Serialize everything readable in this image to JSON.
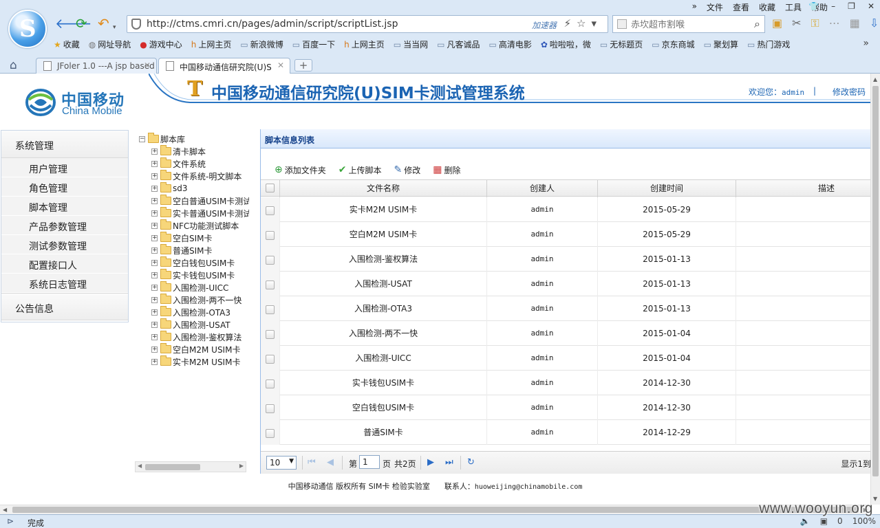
{
  "browser": {
    "menu": [
      "文件",
      "查看",
      "收藏",
      "工具",
      "帮助"
    ],
    "url": "http://ctms.cmri.cn/pages/admin/script/scriptList.jsp",
    "accelerator_label": "加速器",
    "search_placeholder": "赤坎超市割喉",
    "bookmarks": [
      {
        "icon": "star-icon",
        "label": "收藏"
      },
      {
        "icon": "globe-icon",
        "label": "网址导航"
      },
      {
        "icon": "game-icon",
        "label": "游戏中心"
      },
      {
        "icon": "hao-icon",
        "label": "上网主页"
      },
      {
        "icon": "page-icon",
        "label": "新浪微博"
      },
      {
        "icon": "page-icon",
        "label": "百度一下"
      },
      {
        "icon": "hao-icon",
        "label": "上网主页"
      },
      {
        "icon": "page-icon",
        "label": "当当网"
      },
      {
        "icon": "page-icon",
        "label": "凡客诚品"
      },
      {
        "icon": "page-icon",
        "label": "高清电影"
      },
      {
        "icon": "paw-icon",
        "label": "啦啦啦，微"
      },
      {
        "icon": "page-icon",
        "label": "无标题页"
      },
      {
        "icon": "page-icon",
        "label": "京东商城"
      },
      {
        "icon": "page-icon",
        "label": "聚划算"
      },
      {
        "icon": "page-icon",
        "label": "热门游戏"
      }
    ],
    "tabs": [
      {
        "label": "JFoler 1.0 ---A jsp based",
        "active": false
      },
      {
        "label": "中国移动通信研究院(U)S",
        "active": true
      }
    ],
    "status": "完成",
    "zoom": "100%",
    "status_count": "0",
    "watermark": "www.wooyun.org"
  },
  "header": {
    "brand_cn": "中国移动",
    "brand_en": "China Mobile",
    "title": "中国移动通信研究院(U)SIM卡测试管理系统",
    "welcome": "欢迎您：",
    "username": "admin",
    "separator": "|",
    "change_password": "修改密码"
  },
  "leftmenu": {
    "group1": "系统管理",
    "items": [
      "用户管理",
      "角色管理",
      "脚本管理",
      "产品参数管理",
      "测试参数管理",
      "配置接口人",
      "系统日志管理"
    ],
    "group2": "公告信息"
  },
  "tree": {
    "root": "脚本库",
    "children": [
      "清卡脚本",
      "文件系统",
      "文件系统-明文脚本",
      "sd3",
      "空白普通USIM卡测试",
      "实卡普通USIM卡测试",
      "NFC功能测试脚本",
      "空白SIM卡",
      "普通SIM卡",
      "空白钱包USIM卡",
      "实卡钱包USIM卡",
      "入围检测-UICC",
      "入围检测-两不一快",
      "入围检测-OTA3",
      "入围检测-USAT",
      "入围检测-鉴权算法",
      "空白M2M USIM卡",
      "实卡M2M USIM卡"
    ]
  },
  "panel": {
    "title": "脚本信息列表",
    "toolbar": {
      "add_folder": "添加文件夹",
      "upload": "上传脚本",
      "edit": "修改",
      "delete": "删除"
    },
    "columns": [
      "文件名称",
      "创建人",
      "创建时间",
      "描述"
    ],
    "rows": [
      {
        "name": "实卡M2M USIM卡",
        "creator": "admin",
        "date": "2015-05-29",
        "desc": ""
      },
      {
        "name": "空白M2M USIM卡",
        "creator": "admin",
        "date": "2015-05-29",
        "desc": ""
      },
      {
        "name": "入围检测-鉴权算法",
        "creator": "admin",
        "date": "2015-01-13",
        "desc": ""
      },
      {
        "name": "入围检测-USAT",
        "creator": "admin",
        "date": "2015-01-13",
        "desc": ""
      },
      {
        "name": "入围检测-OTA3",
        "creator": "admin",
        "date": "2015-01-13",
        "desc": ""
      },
      {
        "name": "入围检测-两不一快",
        "creator": "admin",
        "date": "2015-01-04",
        "desc": ""
      },
      {
        "name": "入围检测-UICC",
        "creator": "admin",
        "date": "2015-01-04",
        "desc": ""
      },
      {
        "name": "实卡钱包USIM卡",
        "creator": "admin",
        "date": "2014-12-30",
        "desc": ""
      },
      {
        "name": "空白钱包USIM卡",
        "creator": "admin",
        "date": "2014-12-30",
        "desc": ""
      },
      {
        "name": "普通SIM卡",
        "creator": "admin",
        "date": "2014-12-29",
        "desc": ""
      }
    ],
    "pager": {
      "page_size": "10",
      "page_label_before": "第",
      "current_page": "1",
      "page_label_after": "页",
      "total": "共2页",
      "info": "显示1到"
    }
  },
  "footer": {
    "text": "中国移动通信 版权所有 SIM卡 检验实验室",
    "contact_label": "联系人：",
    "contact_email": "huoweijing@chinamobile.com"
  },
  "colors": {
    "accent": "#1b64b3",
    "panel_title": "#15428b",
    "chrome": "#dbe8f6"
  }
}
